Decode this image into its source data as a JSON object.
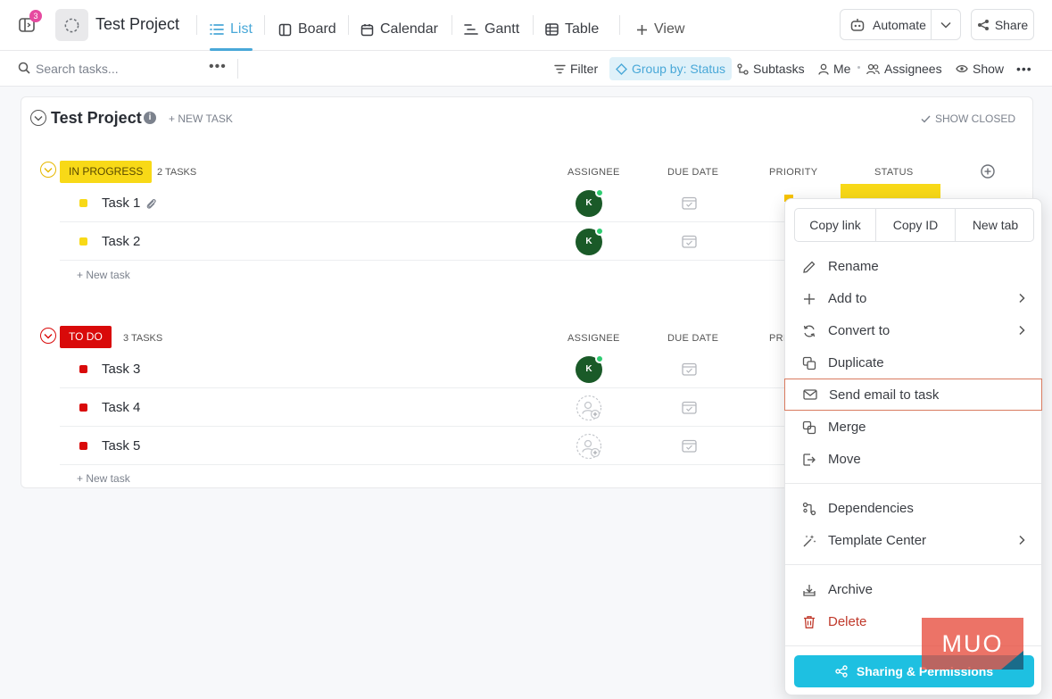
{
  "header": {
    "notification_count": "3",
    "project_title": "Test Project",
    "views": [
      {
        "label": "List",
        "icon": "list-icon",
        "active": true
      },
      {
        "label": "Board",
        "icon": "board-icon"
      },
      {
        "label": "Calendar",
        "icon": "calendar-icon"
      },
      {
        "label": "Gantt",
        "icon": "gantt-icon"
      },
      {
        "label": "Table",
        "icon": "table-icon"
      }
    ],
    "add_view_label": "View",
    "automate_label": "Automate",
    "share_label": "Share"
  },
  "toolbar": {
    "search_placeholder": "Search tasks...",
    "filter_label": "Filter",
    "group_by_label": "Group by: Status",
    "subtasks_label": "Subtasks",
    "me_label": "Me",
    "assignees_label": "Assignees",
    "show_label": "Show"
  },
  "list": {
    "title": "Test Project",
    "info_glyph": "i",
    "new_task_label": "+ NEW TASK",
    "show_closed_label": "SHOW CLOSED",
    "groups": [
      {
        "status": "IN PROGRESS",
        "count_label": "2 TASKS",
        "color": "#f8d917",
        "columns": [
          "ASSIGNEE",
          "DUE DATE",
          "PRIORITY",
          "STATUS"
        ],
        "tasks": [
          {
            "name": "Task 1",
            "assignee": "K",
            "has_attachment": true
          },
          {
            "name": "Task 2",
            "assignee": "K"
          }
        ],
        "new_task_label": "+ New task"
      },
      {
        "status": "TO DO",
        "count_label": "3 TASKS",
        "color": "#d90a0a",
        "columns": [
          "ASSIGNEE",
          "DUE DATE",
          "PRI"
        ],
        "tasks": [
          {
            "name": "Task 3",
            "assignee": "K"
          },
          {
            "name": "Task 4",
            "assignee": ""
          },
          {
            "name": "Task 5",
            "assignee": ""
          }
        ],
        "new_task_label": "+ New task"
      }
    ]
  },
  "context_menu": {
    "buttons": [
      "Copy link",
      "Copy ID",
      "New tab"
    ],
    "items": [
      {
        "label": "Rename",
        "icon": "pencil-icon"
      },
      {
        "label": "Add to",
        "icon": "plus-icon",
        "submenu": true
      },
      {
        "label": "Convert to",
        "icon": "convert-icon",
        "submenu": true
      },
      {
        "label": "Duplicate",
        "icon": "duplicate-icon"
      },
      {
        "label": "Send email to task",
        "icon": "mail-icon",
        "highlighted": true
      },
      {
        "label": "Merge",
        "icon": "merge-icon"
      },
      {
        "label": "Move",
        "icon": "move-icon"
      },
      {
        "label": "Dependencies",
        "icon": "dependencies-icon"
      },
      {
        "label": "Template Center",
        "icon": "template-icon",
        "submenu": true
      },
      {
        "label": "Archive",
        "icon": "archive-icon"
      },
      {
        "label": "Delete",
        "icon": "trash-icon",
        "danger": true
      }
    ],
    "sharing_label": "Sharing & Permissions"
  },
  "watermark": {
    "text": "MUO"
  },
  "colors": {
    "accent": "#49a8d8",
    "sharing": "#1ec0e1",
    "highlight_border": "#d97b5f",
    "danger": "#c0392b"
  }
}
